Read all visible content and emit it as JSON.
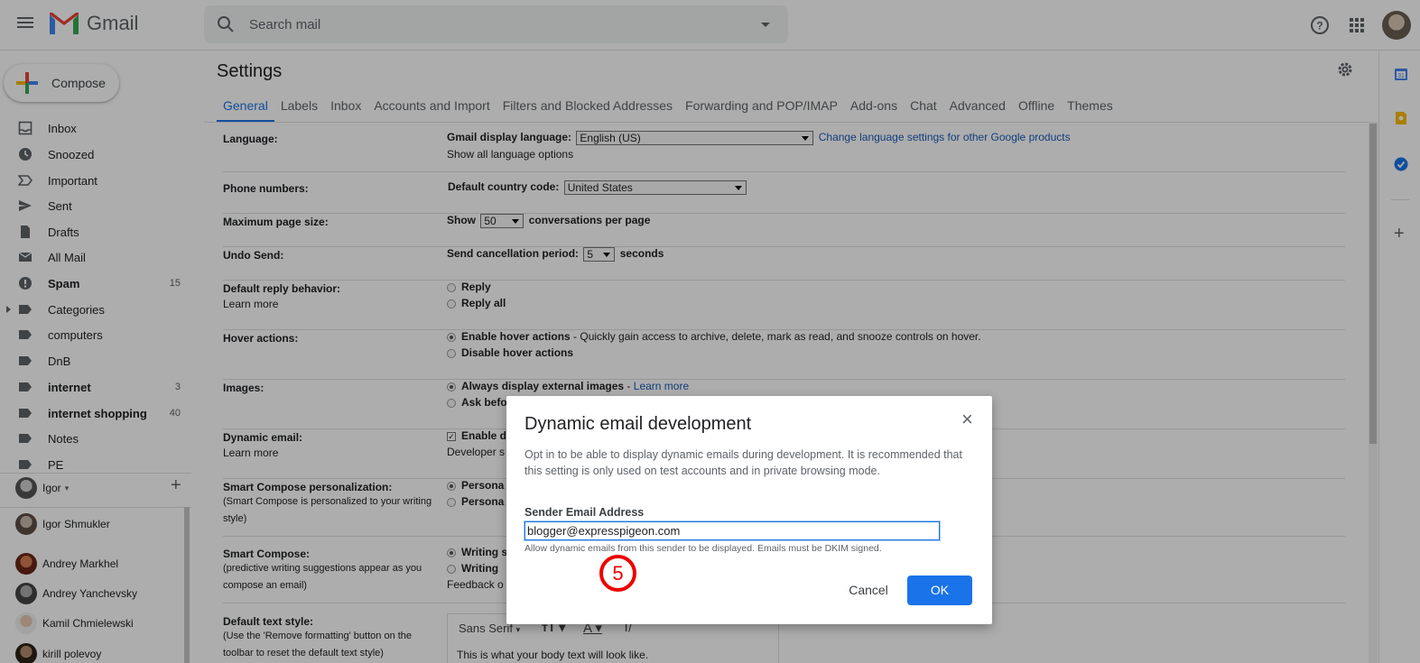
{
  "header": {
    "app_name": "Gmail",
    "search_placeholder": "Search mail"
  },
  "sidebar": {
    "compose_label": "Compose",
    "items": [
      {
        "label": "Inbox",
        "count": "",
        "bold": false
      },
      {
        "label": "Snoozed",
        "count": "",
        "bold": false
      },
      {
        "label": "Important",
        "count": "",
        "bold": false
      },
      {
        "label": "Sent",
        "count": "",
        "bold": false
      },
      {
        "label": "Drafts",
        "count": "",
        "bold": false
      },
      {
        "label": "All Mail",
        "count": "",
        "bold": false
      },
      {
        "label": "Spam",
        "count": "15",
        "bold": true
      },
      {
        "label": "Categories",
        "count": "",
        "bold": false
      },
      {
        "label": "computers",
        "count": "",
        "bold": false
      },
      {
        "label": "DnB",
        "count": "",
        "bold": false
      },
      {
        "label": "internet",
        "count": "3",
        "bold": true
      },
      {
        "label": "internet shopping",
        "count": "40",
        "bold": true
      },
      {
        "label": "Notes",
        "count": "",
        "bold": false
      },
      {
        "label": "PE",
        "count": "",
        "bold": false
      }
    ]
  },
  "hangouts": {
    "user": "Igor",
    "contacts": [
      "Igor Shmukler",
      "Andrey Markhel",
      "Andrey Yanchevsky",
      "Kamil Chmielewski",
      "kirill polevoy"
    ]
  },
  "settings": {
    "title": "Settings",
    "tabs": [
      "General",
      "Labels",
      "Inbox",
      "Accounts and Import",
      "Filters and Blocked Addresses",
      "Forwarding and POP/IMAP",
      "Add-ons",
      "Chat",
      "Advanced",
      "Offline",
      "Themes"
    ],
    "language": {
      "label": "Language:",
      "display_label": "Gmail display language:",
      "value": "English (US)",
      "change_link": "Change language settings for other Google products",
      "show_all": "Show all language options"
    },
    "phone": {
      "label": "Phone numbers:",
      "country_label": "Default country code:",
      "value": "United States"
    },
    "page_size": {
      "label": "Maximum page size:",
      "show": "Show",
      "value": "50",
      "suffix": "conversations per page"
    },
    "undo": {
      "label": "Undo Send:",
      "period_label": "Send cancellation period:",
      "value": "5",
      "suffix": "seconds"
    },
    "reply": {
      "label": "Default reply behavior:",
      "learn_more": "Learn more",
      "opt1": "Reply",
      "opt2": "Reply all"
    },
    "hover": {
      "label": "Hover actions:",
      "opt1": "Enable hover actions",
      "opt1_desc": " - Quickly gain access to archive, delete, mark as read, and snooze controls on hover.",
      "opt2": "Disable hover actions"
    },
    "images": {
      "label": "Images:",
      "opt1": "Always display external images",
      "opt1_sep": " - ",
      "opt1_link": "Learn more",
      "opt2": "Ask befo"
    },
    "dynamic": {
      "label": "Dynamic email:",
      "learn_more": "Learn more",
      "opt1": "Enable d",
      "dev_link": "Developer s"
    },
    "smart_personal": {
      "label": "Smart Compose personalization:",
      "sub": "(Smart Compose is personalized to your writing style)",
      "opt1": "Persona",
      "opt2": "Persona"
    },
    "smart_compose": {
      "label": "Smart Compose:",
      "sub": "(predictive writing suggestions appear as you compose an email)",
      "opt1": "Writing s",
      "opt2": "Writing",
      "feedback": "Feedback o"
    },
    "text_style": {
      "label": "Default text style:",
      "sub": "(Use the 'Remove formatting' button on the toolbar to reset the default text style)",
      "font": "Sans Serif",
      "preview": "This is what your body text will look like."
    }
  },
  "dialog": {
    "title": "Dynamic email development",
    "description": "Opt in to be able to display dynamic emails during development. It is recommended that this setting is only used on test accounts and in private browsing mode.",
    "field_label": "Sender Email Address",
    "field_value": "blogger@expresspigeon.com",
    "help": "Allow dynamic emails from this sender to be displayed. Emails must be DKIM signed.",
    "cancel": "Cancel",
    "ok": "OK"
  },
  "step_badge": "5",
  "colors": {
    "accent": "#1a73e8",
    "link": "#1a5bb8",
    "badge": "#ee0000"
  }
}
